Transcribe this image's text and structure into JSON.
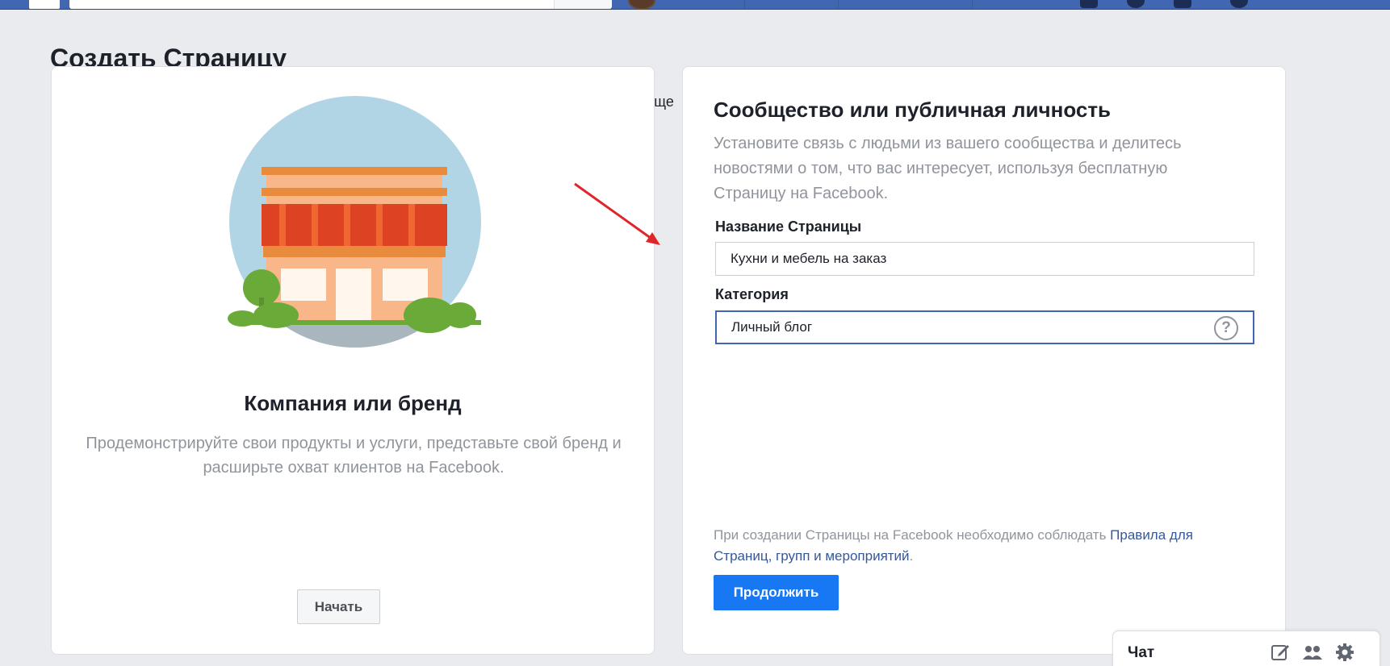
{
  "colors": {
    "brand": "#4267b2",
    "primary_button": "#1877f2",
    "link": "#365899",
    "muted_text": "#90949c"
  },
  "page": {
    "title": "Создать Страницу",
    "background_fragment": "бще"
  },
  "company_card": {
    "title": "Компания или бренд",
    "description": "Продемонстрируйте свои продукты и услуги, представьте свой бренд и расширьте охват клиентов на Facebook.",
    "start_label": "Начать",
    "illustration_icon": "storefront-illustration"
  },
  "community_card": {
    "title": "Сообщество или публичная личность",
    "description": "Установите связь с людьми из вашего сообщества и делитесь новостями о том, что вас интересует, используя бесплатную Страницу на Facebook.",
    "page_name_label": "Название Страницы",
    "page_name_value": "Кухни и мебель на заказ",
    "category_label": "Категория",
    "category_value": "Личный блог",
    "help_icon_glyph": "?",
    "policy_text": "При создании Страницы на Facebook необходимо соблюдать ",
    "policy_link": "Правила для Страниц, групп и мероприятий",
    "policy_end": ".",
    "continue_label": "Продолжить"
  },
  "annotation": {
    "icon": "red-arrow-icon",
    "color": "#e0262b"
  },
  "chat": {
    "label": "Чат",
    "icons": [
      "compose-icon",
      "group-icon",
      "gear-icon"
    ]
  }
}
